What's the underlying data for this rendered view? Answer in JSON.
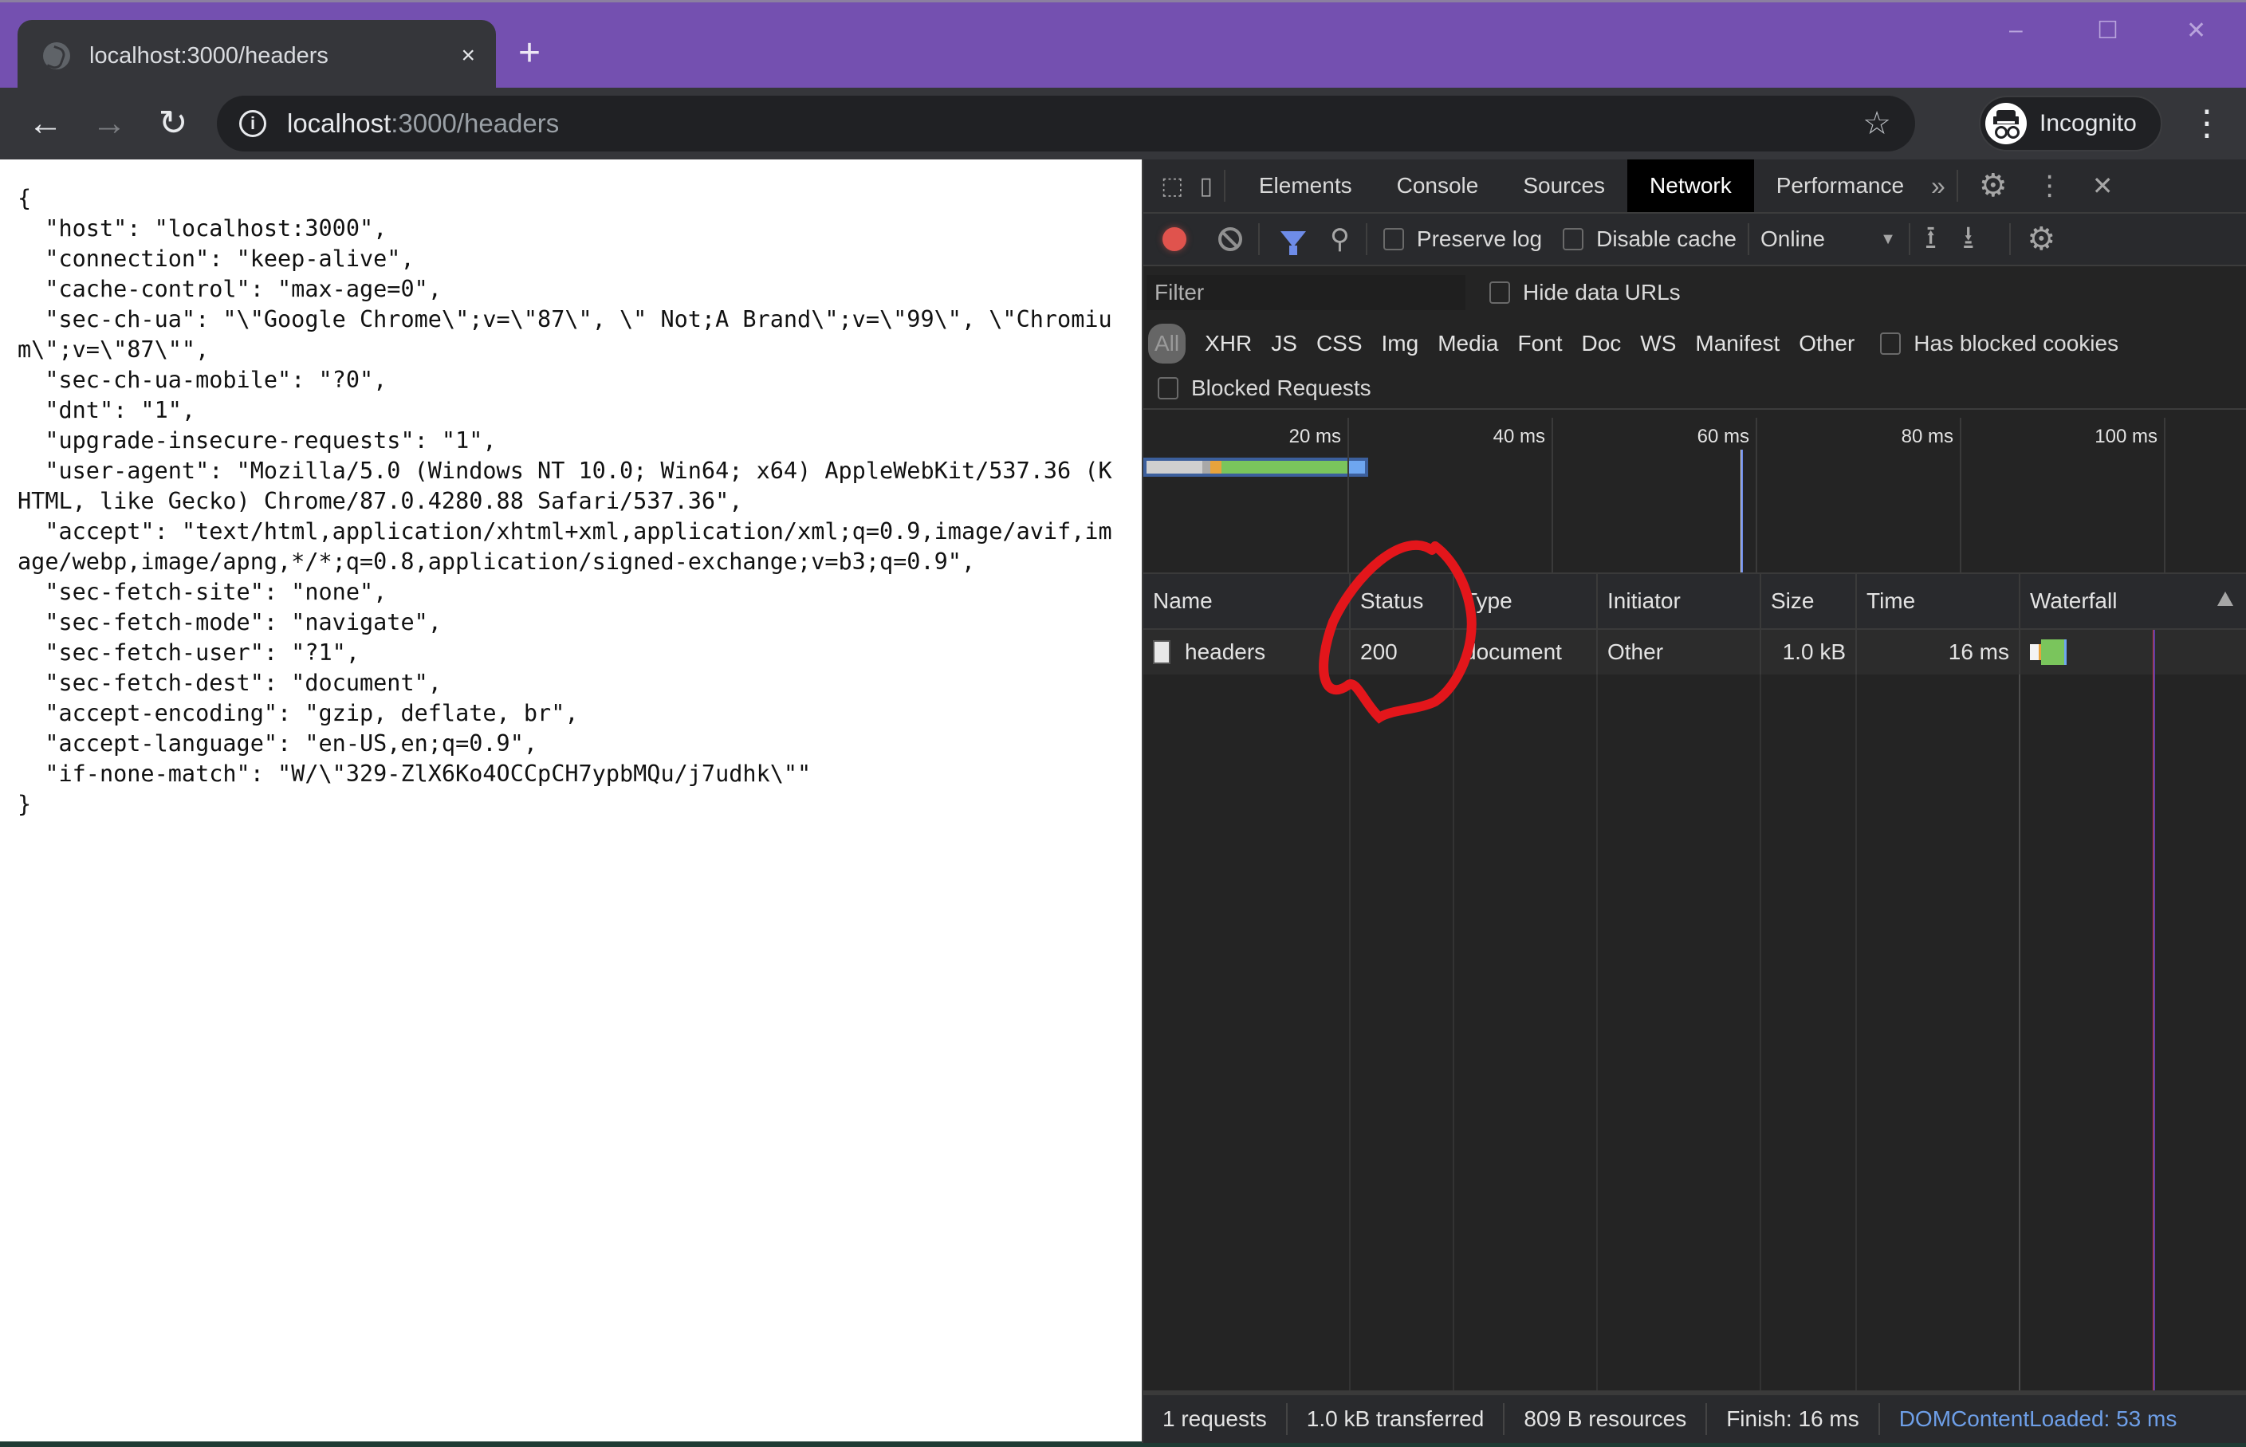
{
  "browser": {
    "tab_title": "localhost:3000/headers",
    "tab_close": "×",
    "new_tab": "+",
    "window_controls": {
      "minimize": "–",
      "maximize": "☐",
      "close": "✕"
    },
    "nav": {
      "back": "←",
      "forward": "→",
      "reload": "↻"
    },
    "url_host": "localhost",
    "url_rest": ":3000/headers",
    "star": "☆",
    "profile_label": "Incognito",
    "menu": "⋮",
    "theme_color": "#7450b0"
  },
  "page": {
    "json_text": "{\n  \"host\": \"localhost:3000\",\n  \"connection\": \"keep-alive\",\n  \"cache-control\": \"max-age=0\",\n  \"sec-ch-ua\": \"\\\"Google Chrome\\\";v=\\\"87\\\", \\\" Not;A Brand\\\";v=\\\"99\\\", \\\"Chromium\\\";v=\\\"87\\\"\",\n  \"sec-ch-ua-mobile\": \"?0\",\n  \"dnt\": \"1\",\n  \"upgrade-insecure-requests\": \"1\",\n  \"user-agent\": \"Mozilla/5.0 (Windows NT 10.0; Win64; x64) AppleWebKit/537.36 (KHTML, like Gecko) Chrome/87.0.4280.88 Safari/537.36\",\n  \"accept\": \"text/html,application/xhtml+xml,application/xml;q=0.9,image/avif,image/webp,image/apng,*/*;q=0.8,application/signed-exchange;v=b3;q=0.9\",\n  \"sec-fetch-site\": \"none\",\n  \"sec-fetch-mode\": \"navigate\",\n  \"sec-fetch-user\": \"?1\",\n  \"sec-fetch-dest\": \"document\",\n  \"accept-encoding\": \"gzip, deflate, br\",\n  \"accept-language\": \"en-US,en;q=0.9\",\n  \"if-none-match\": \"W/\\\"329-ZlX6Ko4OCCpCH7ypbMQu/j7udhk\\\"\"\n}"
  },
  "devtools": {
    "tabs": [
      "Elements",
      "Console",
      "Sources",
      "Network",
      "Performance"
    ],
    "active_tab": "Network",
    "more_tabs": "»",
    "settings": "⚙",
    "kebab": "⋮",
    "close": "✕",
    "toolbar": {
      "preserve_log": "Preserve log",
      "disable_cache": "Disable cache",
      "throttling": "Online",
      "import": "⭱",
      "export": "⭳"
    },
    "filter": {
      "placeholder": "Filter",
      "hide_data_urls": "Hide data URLs",
      "types": [
        "All",
        "XHR",
        "JS",
        "CSS",
        "Img",
        "Media",
        "Font",
        "Doc",
        "WS",
        "Manifest",
        "Other"
      ],
      "has_blocked_cookies": "Has blocked cookies",
      "blocked_requests": "Blocked Requests"
    },
    "timeline": {
      "ticks": [
        "20 ms",
        "40 ms",
        "60 ms",
        "80 ms",
        "100 ms"
      ],
      "request_end_ms": 22,
      "dom_content_loaded_ms": 58.5
    },
    "table": {
      "headers": [
        "Name",
        "Status",
        "Type",
        "Initiator",
        "Size",
        "Time",
        "Waterfall"
      ],
      "rows": [
        {
          "name": "headers",
          "status": "200",
          "type": "document",
          "initiator": "Other",
          "size": "1.0 kB",
          "time": "16 ms"
        }
      ]
    },
    "footer": {
      "requests": "1 requests",
      "transferred": "1.0 kB transferred",
      "resources": "809 B resources",
      "finish": "Finish: 16 ms",
      "dcl": "DOMContentLoaded: 53 ms"
    },
    "colors": {
      "record": "#e0534d",
      "filter_active": "#6e8ce8",
      "timing_waiting": "#7ac55c",
      "timing_stalled": "#e8a33c",
      "dcl": "#6e9fe8"
    }
  },
  "annotation": {
    "shape": "hand-drawn circle around Status column",
    "color": "#e3161b"
  }
}
